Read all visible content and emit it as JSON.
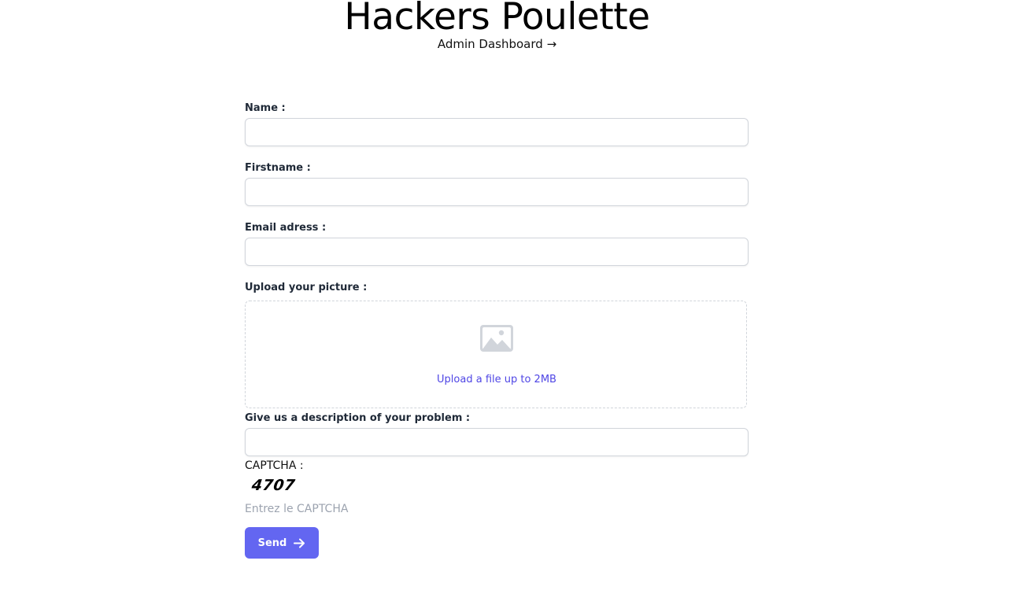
{
  "header": {
    "title": "Hackers Poulette",
    "admin_link": "Admin Dashboard →"
  },
  "form": {
    "name_label": "Name :",
    "name_value": "",
    "firstname_label": "Firstname :",
    "firstname_value": "",
    "email_label": "Email adress :",
    "email_value": "",
    "picture_label": "Upload your picture :",
    "upload_text": "Upload a file up to 2MB",
    "upload_icon": "photo-icon",
    "description_label": "Give us a description of your problem :",
    "description_value": "",
    "captcha_label": "CAPTCHA :",
    "captcha_code": "4707",
    "captcha_placeholder": "Entrez le CAPTCHA",
    "captcha_value": "",
    "send_label": "Send",
    "send_icon": "arrow-right-icon"
  },
  "colors": {
    "accent": "#6366f1",
    "link": "#4f46e5",
    "border": "#d1d5db",
    "placeholder": "#9ca3af"
  }
}
